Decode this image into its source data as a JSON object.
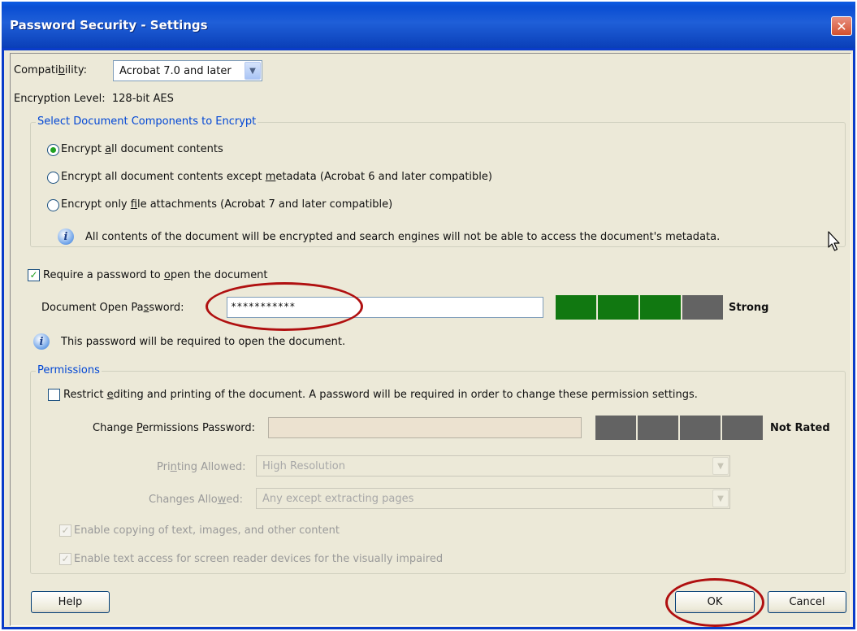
{
  "window": {
    "title": "Password Security - Settings",
    "close_glyph": "✕"
  },
  "compatibility": {
    "label_pre": "Compati",
    "label_ul": "b",
    "label_post": "ility:",
    "value": "Acrobat 7.0 and later",
    "arrow": "▼"
  },
  "encryption": {
    "label": "Encryption Level:",
    "value": "128-bit AES"
  },
  "components": {
    "legend": "Select Document Components to Encrypt",
    "opt1": {
      "pre": "Encrypt ",
      "ul": "a",
      "post": "ll document contents",
      "selected": true
    },
    "opt2": {
      "pre": "Encrypt all document contents except ",
      "ul": "m",
      "post": "etadata (Acrobat 6 and later compatible)",
      "selected": false
    },
    "opt3": {
      "pre": "Encrypt only ",
      "ul": "f",
      "post": "ile attachments (Acrobat 7 and later compatible)",
      "selected": false
    },
    "info": "All contents of the document will be encrypted and search engines will not be able to access the document's metadata."
  },
  "open_password": {
    "require_pre": "Require a password to ",
    "require_ul": "o",
    "require_post": "pen the document",
    "require_checked": "✓",
    "field_label_pre": "Document Open Pa",
    "field_label_ul": "s",
    "field_label_post": "sword:",
    "field_value": "***********",
    "strength": "Strong",
    "info": "This password will be required to open the document."
  },
  "permissions": {
    "legend": "Permissions",
    "restrict_pre": "Restrict ",
    "restrict_ul": "e",
    "restrict_post": "diting and printing of the document. A password will be required in order to change these permission settings.",
    "change_label_pre": "Change ",
    "change_label_ul": "P",
    "change_label_post": "ermissions Password:",
    "change_strength": "Not Rated",
    "printing_label_pre": "Pri",
    "printing_label_ul": "n",
    "printing_label_post": "ting Allowed:",
    "printing_value": "High Resolution",
    "changes_label_pre": "Changes Allo",
    "changes_label_ul": "w",
    "changes_label_post": "ed:",
    "changes_value": "Any except extracting pages",
    "copy_label": "Enable copying of text, images, and other content",
    "access_label": "Enable text access for screen reader devices for the visually impaired",
    "check_glyph": "✓"
  },
  "buttons": {
    "help": "Help",
    "ok": "OK",
    "cancel": "Cancel"
  },
  "icons": {
    "info": "i",
    "combo_arrow": "▼"
  },
  "colors": {
    "meter_strong": "#117811",
    "meter_empty": "#636363",
    "annotation": "#b01010",
    "legend": "#0046d5"
  }
}
